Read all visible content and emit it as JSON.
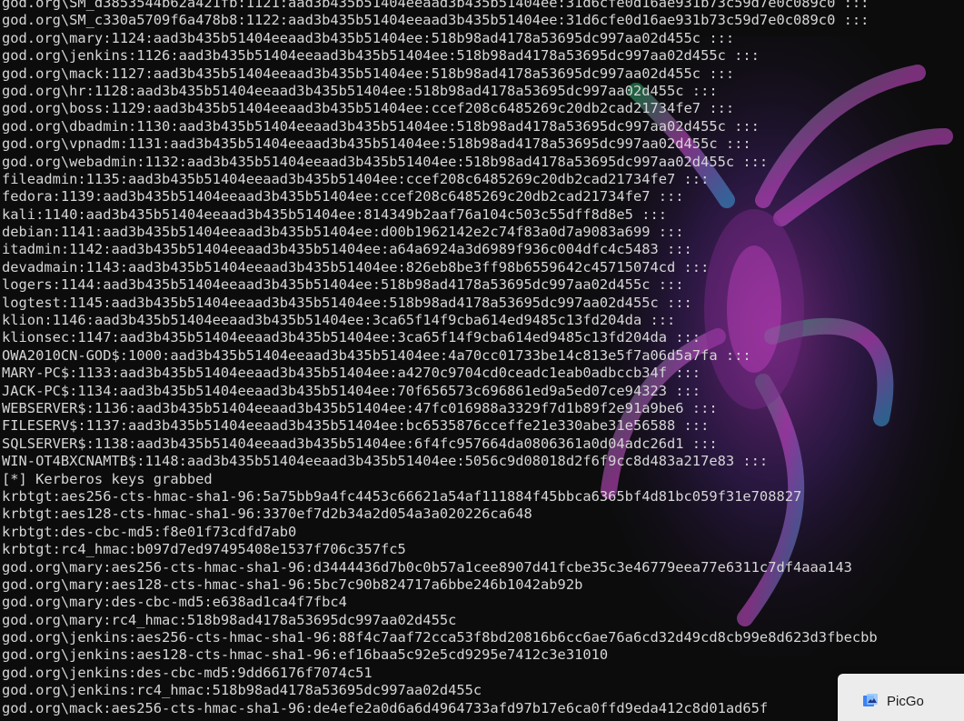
{
  "terminal": {
    "lines": [
      "god.org\\SM_d3853544b62a421fb:1121:aad3b435b51404eeaad3b435b51404ee:31d6cfe0d16ae931b73c59d7e0c089c0 :::",
      "god.org\\SM_c330a5709f6a478b8:1122:aad3b435b51404eeaad3b435b51404ee:31d6cfe0d16ae931b73c59d7e0c089c0 :::",
      "god.org\\mary:1124:aad3b435b51404eeaad3b435b51404ee:518b98ad4178a53695dc997aa02d455c :::",
      "god.org\\jenkins:1126:aad3b435b51404eeaad3b435b51404ee:518b98ad4178a53695dc997aa02d455c :::",
      "god.org\\mack:1127:aad3b435b51404eeaad3b435b51404ee:518b98ad4178a53695dc997aa02d455c :::",
      "god.org\\hr:1128:aad3b435b51404eeaad3b435b51404ee:518b98ad4178a53695dc997aa02d455c :::",
      "god.org\\boss:1129:aad3b435b51404eeaad3b435b51404ee:ccef208c6485269c20db2cad21734fe7 :::",
      "god.org\\dbadmin:1130:aad3b435b51404eeaad3b435b51404ee:518b98ad4178a53695dc997aa02d455c :::",
      "god.org\\vpnadm:1131:aad3b435b51404eeaad3b435b51404ee:518b98ad4178a53695dc997aa02d455c :::",
      "god.org\\webadmin:1132:aad3b435b51404eeaad3b435b51404ee:518b98ad4178a53695dc997aa02d455c :::",
      "fileadmin:1135:aad3b435b51404eeaad3b435b51404ee:ccef208c6485269c20db2cad21734fe7 :::",
      "fedora:1139:aad3b435b51404eeaad3b435b51404ee:ccef208c6485269c20db2cad21734fe7 :::",
      "kali:1140:aad3b435b51404eeaad3b435b51404ee:814349b2aaf76a104c503c55dff8d8e5 :::",
      "debian:1141:aad3b435b51404eeaad3b435b51404ee:d00b1962142e2c74f83a0d7a9083a699 :::",
      "itadmin:1142:aad3b435b51404eeaad3b435b51404ee:a64a6924a3d6989f936c004dfc4c5483 :::",
      "devadmain:1143:aad3b435b51404eeaad3b435b51404ee:826eb8be3ff98b6559642c45715074cd :::",
      "logers:1144:aad3b435b51404eeaad3b435b51404ee:518b98ad4178a53695dc997aa02d455c :::",
      "logtest:1145:aad3b435b51404eeaad3b435b51404ee:518b98ad4178a53695dc997aa02d455c :::",
      "klion:1146:aad3b435b51404eeaad3b435b51404ee:3ca65f14f9cba614ed9485c13fd204da :::",
      "klionsec:1147:aad3b435b51404eeaad3b435b51404ee:3ca65f14f9cba614ed9485c13fd204da :::",
      "OWA2010CN-GOD$:1000:aad3b435b51404eeaad3b435b51404ee:4a70cc01733be14c813e5f7a06d5a7fa :::",
      "MARY-PC$:1133:aad3b435b51404eeaad3b435b51404ee:a4270c9704cd0ceadc1eab0adbccb34f :::",
      "JACK-PC$:1134:aad3b435b51404eeaad3b435b51404ee:70f656573c696861ed9a5ed07ce94323 :::",
      "WEBSERVER$:1136:aad3b435b51404eeaad3b435b51404ee:47fc016988a3329f7d1b89f2e91a9be6 :::",
      "FILESERV$:1137:aad3b435b51404eeaad3b435b51404ee:bc6535876cceffe21e330abe31e56588 :::",
      "SQLSERVER$:1138:aad3b435b51404eeaad3b435b51404ee:6f4fc957664da0806361a0d04adc26d1 :::",
      "WIN-OT4BXCNAMTB$:1148:aad3b435b51404eeaad3b435b51404ee:5056c9d08018d2f6f9cc8d483a217e83 :::",
      "[*] Kerberos keys grabbed",
      "krbtgt:aes256-cts-hmac-sha1-96:5a75bb9a4fc4453c66621a54af111884f45bbca6365bf4d81bc059f31e708827",
      "krbtgt:aes128-cts-hmac-sha1-96:3370ef7d2b34a2d054a3a020226ca648",
      "krbtgt:des-cbc-md5:f8e01f73cdfd7ab0",
      "krbtgt:rc4_hmac:b097d7ed97495408e1537f706c357fc5",
      "god.org\\mary:aes256-cts-hmac-sha1-96:d3444436d7b0c0b57a1cee8907d41fcbe35c3e46779eea77e6311c7df4aaa143",
      "god.org\\mary:aes128-cts-hmac-sha1-96:5bc7c90b824717a6bbe246b1042ab92b",
      "god.org\\mary:des-cbc-md5:e638ad1ca4f7fbc4",
      "god.org\\mary:rc4_hmac:518b98ad4178a53695dc997aa02d455c",
      "god.org\\jenkins:aes256-cts-hmac-sha1-96:88f4c7aaf72cca53f8bd20816b6cc6ae76a6cd32d49cd8cb99e8d623d3fbecbb",
      "god.org\\jenkins:aes128-cts-hmac-sha1-96:ef16baa5c92e5cd9295e7412c3e31010",
      "god.org\\jenkins:des-cbc-md5:9dd66176f7074c51",
      "god.org\\jenkins:rc4_hmac:518b98ad4178a53695dc997aa02d455c",
      "god.org\\mack:aes256-cts-hmac-sha1-96:de4efe2a0d6a6d4964733afd97b17e6ca0ffd9eda412c8d01ad65f"
    ]
  },
  "toast": {
    "app_name": "PicGo",
    "icon": "picgo-app-icon"
  },
  "colors": {
    "background": "#0c0c0c",
    "text": "#d6d6d6",
    "toast_bg": "#ececec",
    "icon_accent": "#3b82f6"
  }
}
